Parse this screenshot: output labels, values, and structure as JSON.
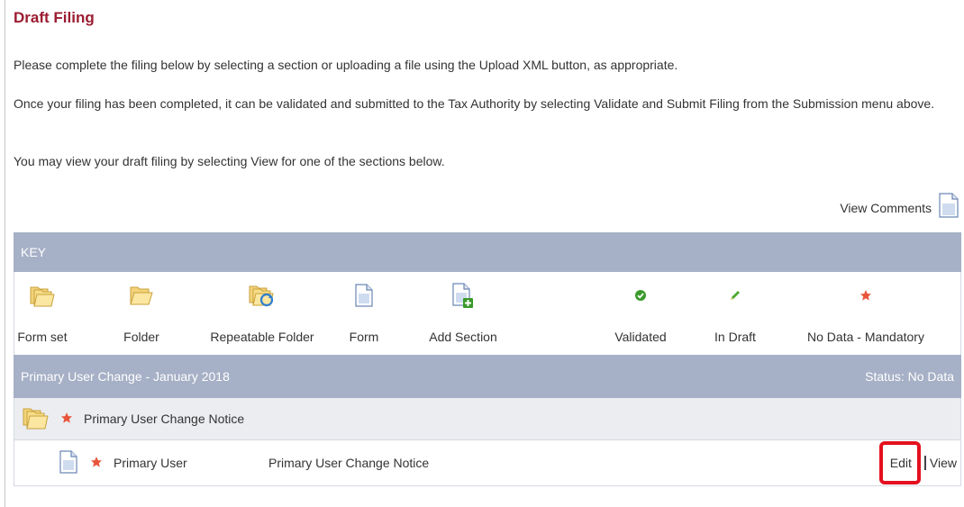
{
  "page": {
    "title": "Draft Filing",
    "paragraph1": "Please complete the filing below by selecting a section or uploading a file using the Upload XML button, as appropriate.",
    "paragraph2": "Once your filing has been completed, it can be validated and submitted to the Tax Authority by selecting Validate and Submit Filing from the Submission menu above.",
    "paragraph3": "You may view your draft filing by selecting View for one of the sections below."
  },
  "view_comments": {
    "label": "View Comments",
    "icon": "document-icon"
  },
  "key": {
    "header": "KEY",
    "items": [
      {
        "label": "Form set",
        "icon": "form-set-folder-icon"
      },
      {
        "label": "Folder",
        "icon": "folder-icon"
      },
      {
        "label": "Repeatable Folder",
        "icon": "repeatable-folder-icon"
      },
      {
        "label": "Form",
        "icon": "form-icon"
      },
      {
        "label": "Add Section",
        "icon": "add-section-icon"
      },
      {
        "label": "Validated",
        "icon": "check-circle-icon"
      },
      {
        "label": "In Draft",
        "icon": "pencil-icon"
      },
      {
        "label": "No Data - Mandatory",
        "icon": "star-icon"
      }
    ]
  },
  "filing": {
    "title": "Primary User Change - January 2018",
    "status": "Status: No Data",
    "group": {
      "label": "Primary User Change Notice",
      "icon": "form-set-folder-icon",
      "status_icon": "star-icon"
    },
    "item": {
      "name": "Primary User",
      "description": "Primary User Change Notice",
      "edit_label": "Edit",
      "view_label": "View",
      "icon": "form-icon",
      "status_icon": "star-icon"
    }
  },
  "colors": {
    "title": "#9b1c31",
    "bar": "#a6b0c6",
    "highlight": "#e4101f",
    "star": "#e8553a",
    "validated": "#3a9a2a"
  }
}
